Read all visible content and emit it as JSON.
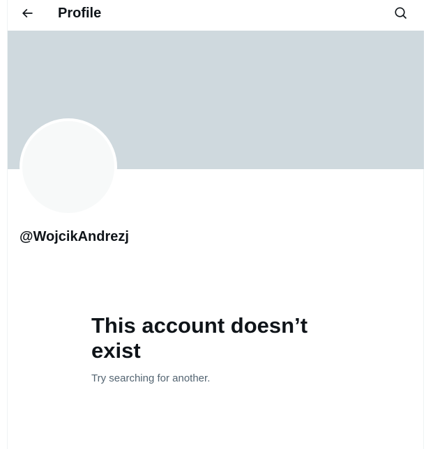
{
  "header": {
    "title": "Profile",
    "back_icon": "arrow-left-icon",
    "search_icon": "search-icon"
  },
  "profile": {
    "handle": "@WojcikAndrezj",
    "banner_color": "#cfd9de",
    "avatar_color": "#f7f9f9"
  },
  "empty_state": {
    "title": "This account doesn’t exist",
    "subtitle": "Try searching for another."
  }
}
